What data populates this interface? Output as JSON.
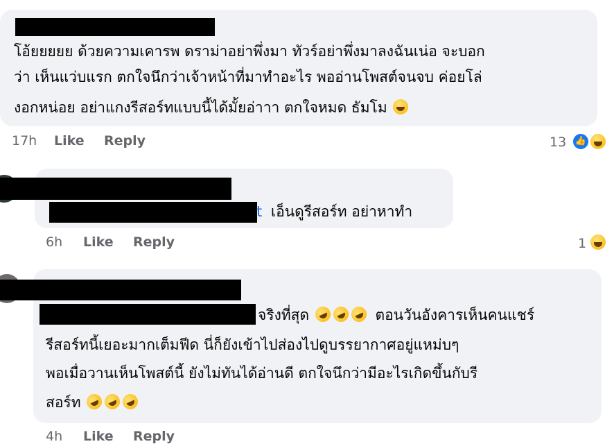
{
  "comments": [
    {
      "lines": [
        "โอ้ยยยยย ด้วยความเคารพ ดราม่าอย่าพึ่งมา ทัวร์อย่าพึ่งมาลงฉันเน่อ จะบอก",
        "ว่า เห็นแว่บแรก ตกใจนึกว่าเจ้าหน้าที่มาทำอะไร พออ่านโพสต์จนจบ ค่อยโล่",
        "งอกหน่อย อย่าแกงรีสอร์ทแบบนี้ได้มั้ยอ่าาา ตกใจหมด ธัมโม"
      ],
      "time": "17h",
      "like": "Like",
      "reply": "Reply",
      "reaction_count": "13",
      "reaction_icons": [
        "like-icon",
        "haha-icon"
      ]
    },
    {
      "mention_tail": "t",
      "text": "เอ็นดูรีสอร์ท อย่าหาทำ",
      "time": "6h",
      "like": "Like",
      "reply": "Reply",
      "reaction_count": "1",
      "reaction_icons": [
        "haha-icon"
      ]
    },
    {
      "line1": "จริงที่สุด",
      "line1b": "ตอนวันอังคารเห็นคนแชร์",
      "lines": [
        "รีสอร์ทนี้เยอะมากเต็มฟีด นี่ก็ยังเข้าไปส่องไปดูบรรยากาศอยู่แหม่บๆ",
        "พอเมื่อวานเห็นโพสต์นี้ ยังไม่ทันได้อ่านดี ตกใจนึกว่ามีอะไรเกิดขึ้นกับรี"
      ],
      "last_line": "สอร์ท",
      "time": "4h",
      "like": "Like",
      "reply": "Reply"
    }
  ],
  "colors": {
    "bubble": "#f0f2f5",
    "meta_text": "#65676b",
    "mention": "#216fdb",
    "like_blue": "#1877f2"
  }
}
